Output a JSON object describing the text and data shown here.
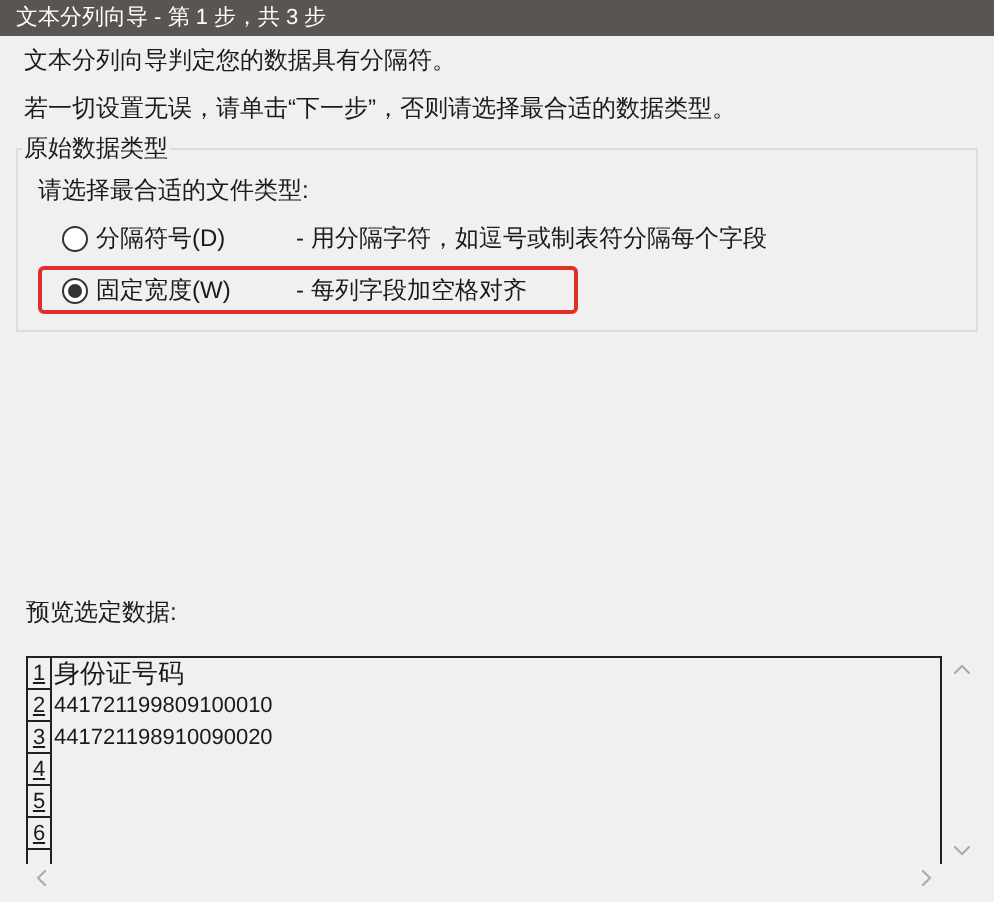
{
  "window": {
    "title": "文本分列向导 - 第 1 步，共 3 步"
  },
  "intro": [
    "文本分列向导判定您的数据具有分隔符。",
    "若一切设置无误，请单击“下一步”，否则请选择最合适的数据类型。"
  ],
  "group": {
    "title": "原始数据类型",
    "prompt": "请选择最合适的文件类型:",
    "options": [
      {
        "label": "分隔符号(D)",
        "description": "- 用分隔字符，如逗号或制表符分隔每个字段",
        "selected": false,
        "highlighted": false
      },
      {
        "label": "固定宽度(W)",
        "description": "- 每列字段加空格对齐",
        "selected": true,
        "highlighted": true
      }
    ]
  },
  "preview": {
    "label": "预览选定数据:",
    "rows": [
      {
        "number": "1",
        "text": "身份证号码"
      },
      {
        "number": "2",
        "text": "441721199809100010"
      },
      {
        "number": "3",
        "text": "441721198910090020"
      },
      {
        "number": "4"
      },
      {
        "number": "5"
      },
      {
        "number": "6"
      }
    ]
  }
}
